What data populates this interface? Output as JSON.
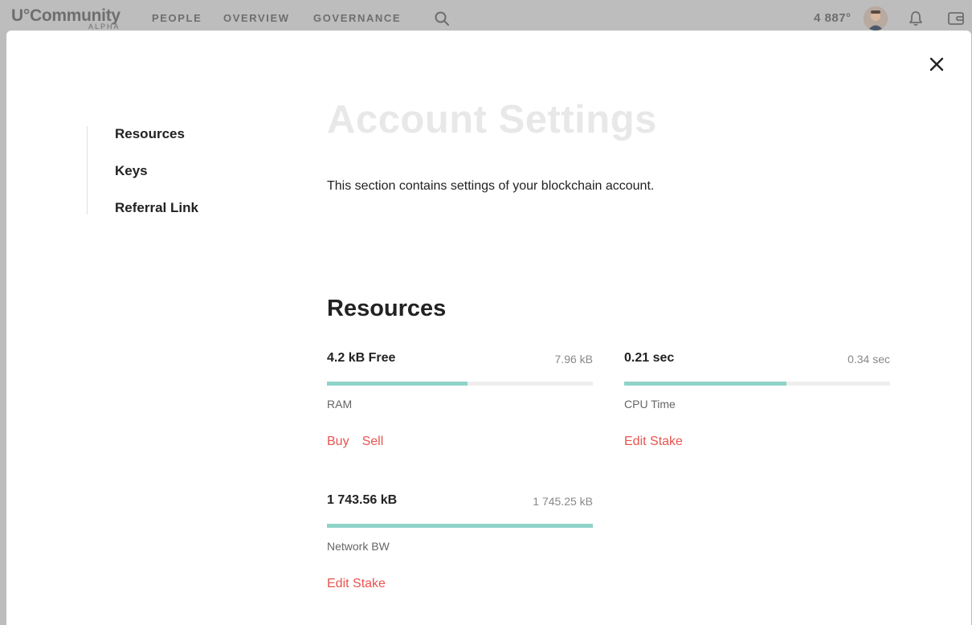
{
  "nav": {
    "logo": "U°Community",
    "logo_sub": "ALPHA",
    "links": [
      "PEOPLE",
      "OVERVIEW",
      "GOVERNANCE"
    ],
    "balance": "4 887°"
  },
  "sidebar": {
    "items": [
      {
        "label": "Resources"
      },
      {
        "label": "Keys"
      },
      {
        "label": "Referral Link"
      }
    ]
  },
  "main": {
    "title": "Account Settings",
    "description": "This section contains settings of your blockchain account.",
    "resources_title": "Resources"
  },
  "resources": [
    {
      "value": "4.2 kB Free",
      "max": "7.96 kB",
      "fill": 0.53,
      "label": "RAM",
      "actions": [
        "Buy",
        "Sell"
      ]
    },
    {
      "value": "0.21 sec",
      "max": "0.34 sec",
      "fill": 0.61,
      "label": "CPU Time",
      "actions": [
        "Edit Stake"
      ]
    },
    {
      "value": "1 743.56 kB",
      "max": "1 745.25 kB",
      "fill": 0.999,
      "label": "Network BW",
      "actions": [
        "Edit Stake"
      ]
    }
  ],
  "colors": {
    "accent": "#e8544f",
    "bar_fill": "#8fd3c9",
    "bar_track": "#eeeeee",
    "title": "#e8e8e8"
  },
  "icons": [
    "search-icon",
    "bell-icon",
    "wallet-icon",
    "close-icon"
  ]
}
